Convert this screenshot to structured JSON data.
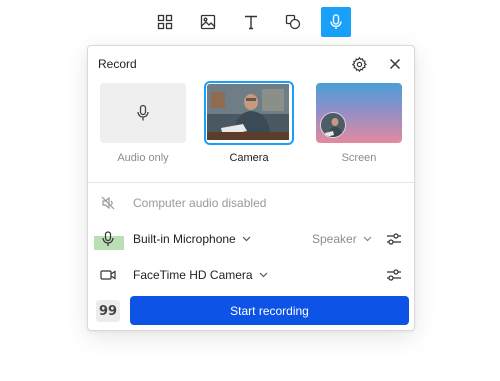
{
  "toolbar": {
    "tools": [
      {
        "name": "frames-icon",
        "active": false
      },
      {
        "name": "image-icon",
        "active": false
      },
      {
        "name": "text-icon",
        "active": false
      },
      {
        "name": "shapes-icon",
        "active": false
      },
      {
        "name": "microphone-icon",
        "active": true
      }
    ],
    "accent": "#18a0fb"
  },
  "panel": {
    "title": "Record",
    "options": {
      "audio": {
        "label": "Audio only",
        "selected": false
      },
      "camera": {
        "label": "Camera",
        "selected": true
      },
      "screen": {
        "label": "Screen",
        "selected": false
      }
    },
    "computer_audio": {
      "label": "Computer audio disabled",
      "icon": "speaker-muted-icon"
    },
    "microphone": {
      "label": "Built-in Microphone",
      "output_label": "Speaker",
      "icon": "microphone-icon"
    },
    "camera": {
      "label": "FaceTime HD Camera",
      "icon": "video-camera-icon"
    },
    "quote_glyph": "99",
    "start_label": "Start recording",
    "start_color": "#0d53e6"
  }
}
